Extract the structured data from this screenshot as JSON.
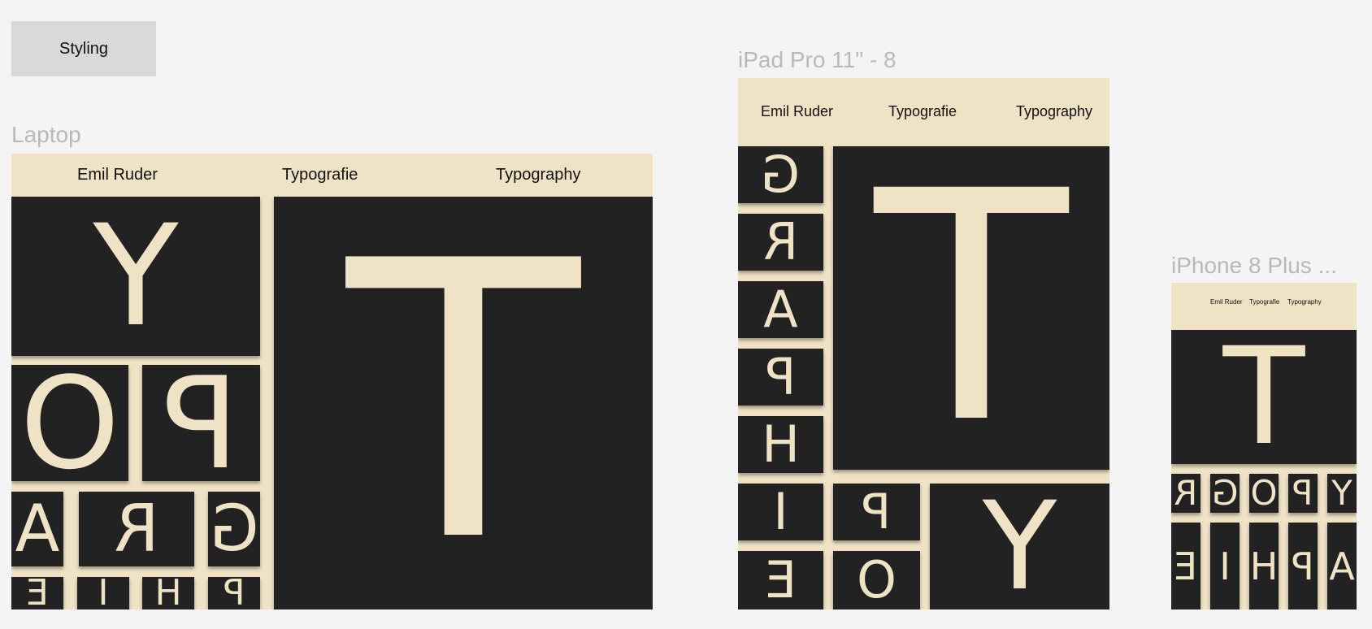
{
  "styling_button": {
    "label": "Styling"
  },
  "frames": {
    "laptop": {
      "label": "Laptop"
    },
    "ipad": {
      "label": "iPad Pro 11\" - 8"
    },
    "iphone": {
      "label": "iPhone 8 Plus ..."
    }
  },
  "nav": {
    "author": "Emil Ruder",
    "title_de": "Typografie",
    "title_en": "Typography"
  },
  "letters": {
    "T": "T",
    "Y": "Y",
    "O": "O",
    "P": "P",
    "A": "A",
    "R": "R",
    "G": "G",
    "E": "E",
    "I": "I",
    "H": "H"
  },
  "colors": {
    "page_bg": "#f4f4f4",
    "cream": "#f0e2c5",
    "tile_dark": "#222222",
    "label_gray": "#b9b9b9",
    "button_bg": "#d9d9d9"
  }
}
